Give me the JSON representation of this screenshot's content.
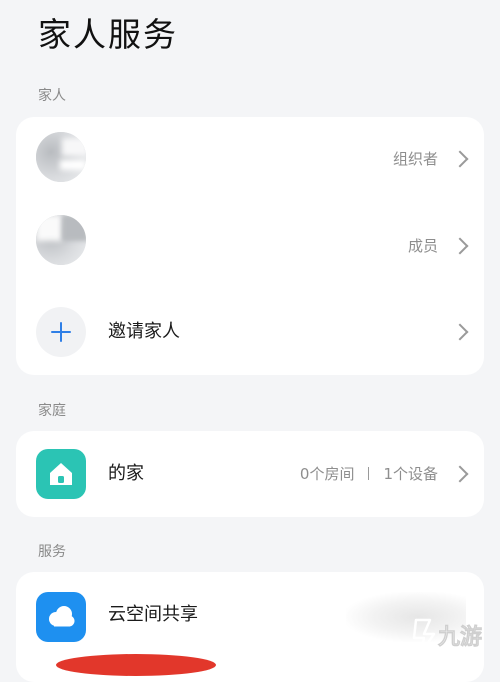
{
  "page_title": "家人服务",
  "sections": {
    "family_label": "家人",
    "home_label": "家庭",
    "service_label": "服务"
  },
  "family_members": [
    {
      "role": "组织者"
    },
    {
      "role": "成员"
    }
  ],
  "invite": {
    "label": "邀请家人"
  },
  "home": {
    "name": "的家",
    "rooms": "0个房间",
    "devices": "1个设备"
  },
  "services": [
    {
      "label": "云空间共享"
    }
  ],
  "watermark": "九游",
  "colors": {
    "accent_blue": "#2f7fe6",
    "home_icon": "#2bc4b4",
    "cloud_icon": "#1e90f0",
    "background": "#f4f5f7"
  }
}
